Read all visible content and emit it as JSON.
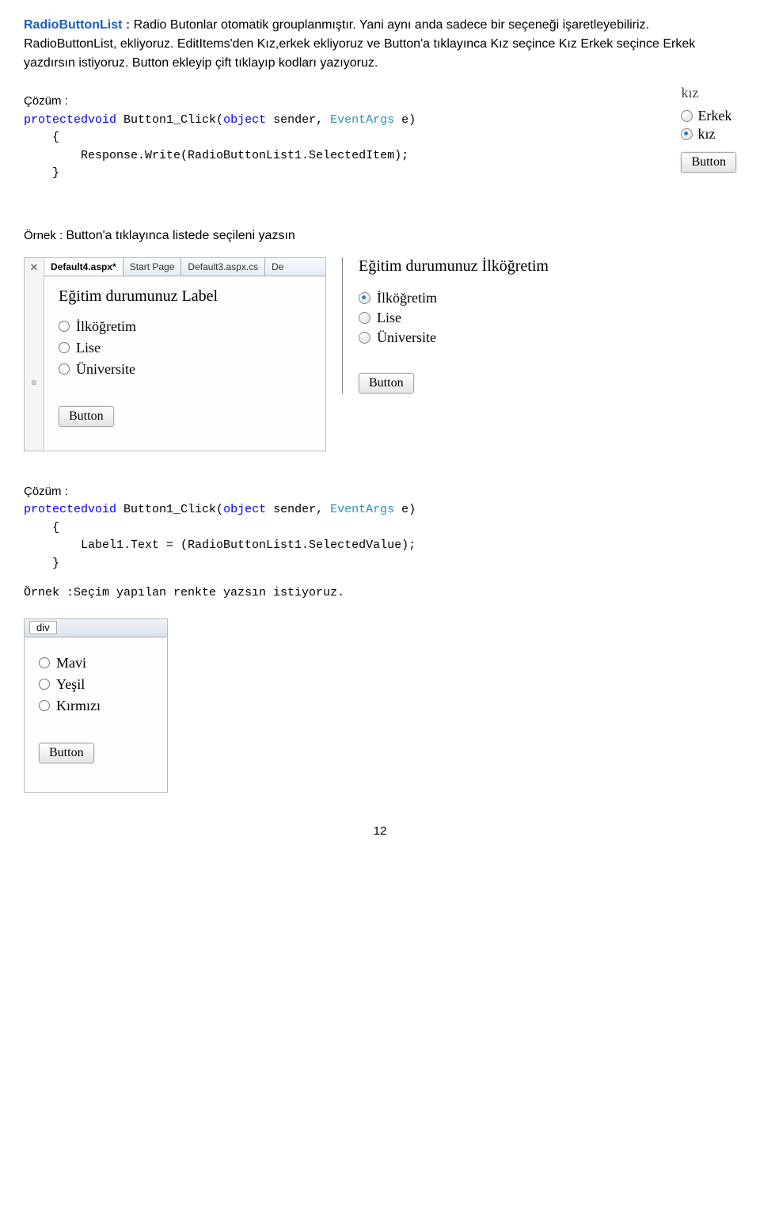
{
  "intro": {
    "term": "RadioButtonList :",
    "p1a": " Radio Butonlar otomatik grouplanmıştır. Yani aynı anda sadece bir seçeneği işaretleyebiliriz. RadioButtonList, ekliyoruz. EditItems'den Kız,erkek ekliyoruz ve Button'a tıklayınca Kız seçince Kız Erkek seçince Erkek yazdırsın istiyoruz. Button ekleyip çift tıklayıp kodları yazıyoruz."
  },
  "code1": {
    "label": "Çözüm :",
    "kw_protectedvoid": "protectedvoid",
    "fn": " Button1_Click(",
    "kw_object": "object",
    "mid": " sender, ",
    "kw_eventargs": "EventArgs",
    "tail": " e)",
    "line2": "    {",
    "line3": "        Response.Write(RadioButtonList1.SelectedItem);",
    "line4": "    }"
  },
  "mini1": {
    "header": "kız",
    "opt1": "Erkek",
    "opt2": "kız",
    "button": "Button"
  },
  "example1": {
    "heading_pre": "Örnek : ",
    "heading": "Button'a tıklayınca listede seçileni yazsın",
    "tabs": [
      "Default4.aspx*",
      "Start Page",
      "Default3.aspx.cs",
      "De"
    ],
    "caption": "Eğitim durumunuz Label",
    "opts": [
      "İlköğretim",
      "Lise",
      "Üniversite"
    ],
    "button": "Button",
    "right_header": "Eğitim durumunuz İlköğretim",
    "right_opts": [
      "İlköğretim",
      "Lise",
      "Üniversite"
    ],
    "right_button": "Button"
  },
  "code2": {
    "label": "Çözüm :",
    "kw_protectedvoid": "protectedvoid",
    "fn": " Button1_Click(",
    "kw_object": "object",
    "mid": " sender, ",
    "kw_eventargs": "EventArgs",
    "tail": " e)",
    "line2": "    {",
    "line3": "        Label1.Text = (RadioButtonList1.SelectedValue);",
    "line4": "    }"
  },
  "example2": {
    "heading": "Örnek :Seçim yapılan renkte yazsın istiyoruz.",
    "tag": "div",
    "opts": [
      "Mavi",
      "Yeşil",
      "Kırmızı"
    ],
    "button": "Button"
  },
  "pagenum": "12"
}
